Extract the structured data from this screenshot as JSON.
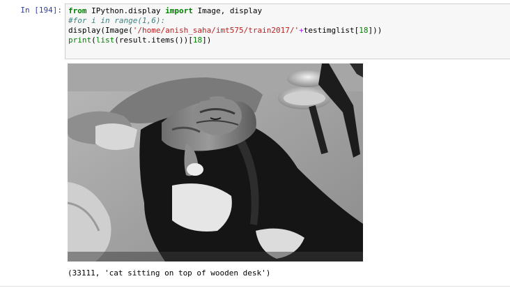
{
  "cell": {
    "prompt": "In [194]:",
    "code": {
      "line1": {
        "kw1": "from",
        "mod": " IPython.display ",
        "kw2": "import",
        "rest": " Image, display"
      },
      "line2": {
        "comment": "#for i in range(1,6):"
      },
      "line3": {
        "pre": "display(Image(",
        "str": "'/home/anish_saha/imt575/train2017/'",
        "op": "+",
        "post": "testimglist[",
        "num": "18",
        "end": "]))"
      },
      "line4": {
        "fn1": "print",
        "p1": "(",
        "fn2": "list",
        "p2": "(result.items())[",
        "num": "18",
        "end": "])"
      }
    },
    "output": {
      "image_description": "grayscale-photo",
      "text": "(33111, 'cat sitting on top of wooden desk')"
    }
  }
}
